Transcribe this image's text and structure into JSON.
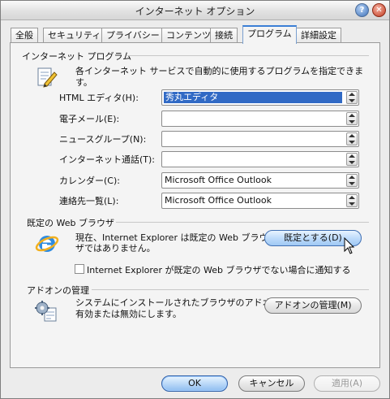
{
  "window": {
    "title": "インターネット オプション"
  },
  "tabs": [
    {
      "label": "全般"
    },
    {
      "label": "セキュリティ"
    },
    {
      "label": "プライバシー"
    },
    {
      "label": "コンテンツ"
    },
    {
      "label": "接続"
    },
    {
      "label": "プログラム"
    },
    {
      "label": "詳細設定"
    }
  ],
  "programs_group": {
    "title": "インターネット プログラム",
    "description": "各インターネット サービスで自動的に使用するプログラムを指定できます。",
    "icon": "document-pencil-icon",
    "rows": [
      {
        "label": "HTML エディタ(H):",
        "value": "秀丸エディタ"
      },
      {
        "label": "電子メール(E):",
        "value": ""
      },
      {
        "label": "ニュースグループ(N):",
        "value": ""
      },
      {
        "label": "インターネット通話(T):",
        "value": ""
      },
      {
        "label": "カレンダー(C):",
        "value": "Microsoft Office Outlook"
      },
      {
        "label": "連絡先一覧(L):",
        "value": "Microsoft Office Outlook"
      }
    ]
  },
  "browser_group": {
    "title": "既定の Web ブラウザ",
    "status_line1": "現在、Internet Explorer は既定の Web ブラウ",
    "status_line2": "ザではありません。",
    "set_default_button": "既定とする(D)",
    "notify_checkbox": "Internet Explorer が既定の Web ブラウザでない場合に通知する",
    "notify_checked": false,
    "icon": "internet-explorer-icon"
  },
  "addons_group": {
    "title": "アドオンの管理",
    "description_line1": "システムにインストールされたブラウザのアドオンを",
    "description_line2": "有効または無効にします。",
    "manage_button": "アドオンの管理(M)",
    "icon": "addons-gear-icon"
  },
  "footer": {
    "ok_button": "OK",
    "cancel_button": "キャンセル",
    "apply_button": "適用(A)"
  },
  "colors": {
    "accent": "#3c7fd6",
    "selection": "#316ac5"
  }
}
